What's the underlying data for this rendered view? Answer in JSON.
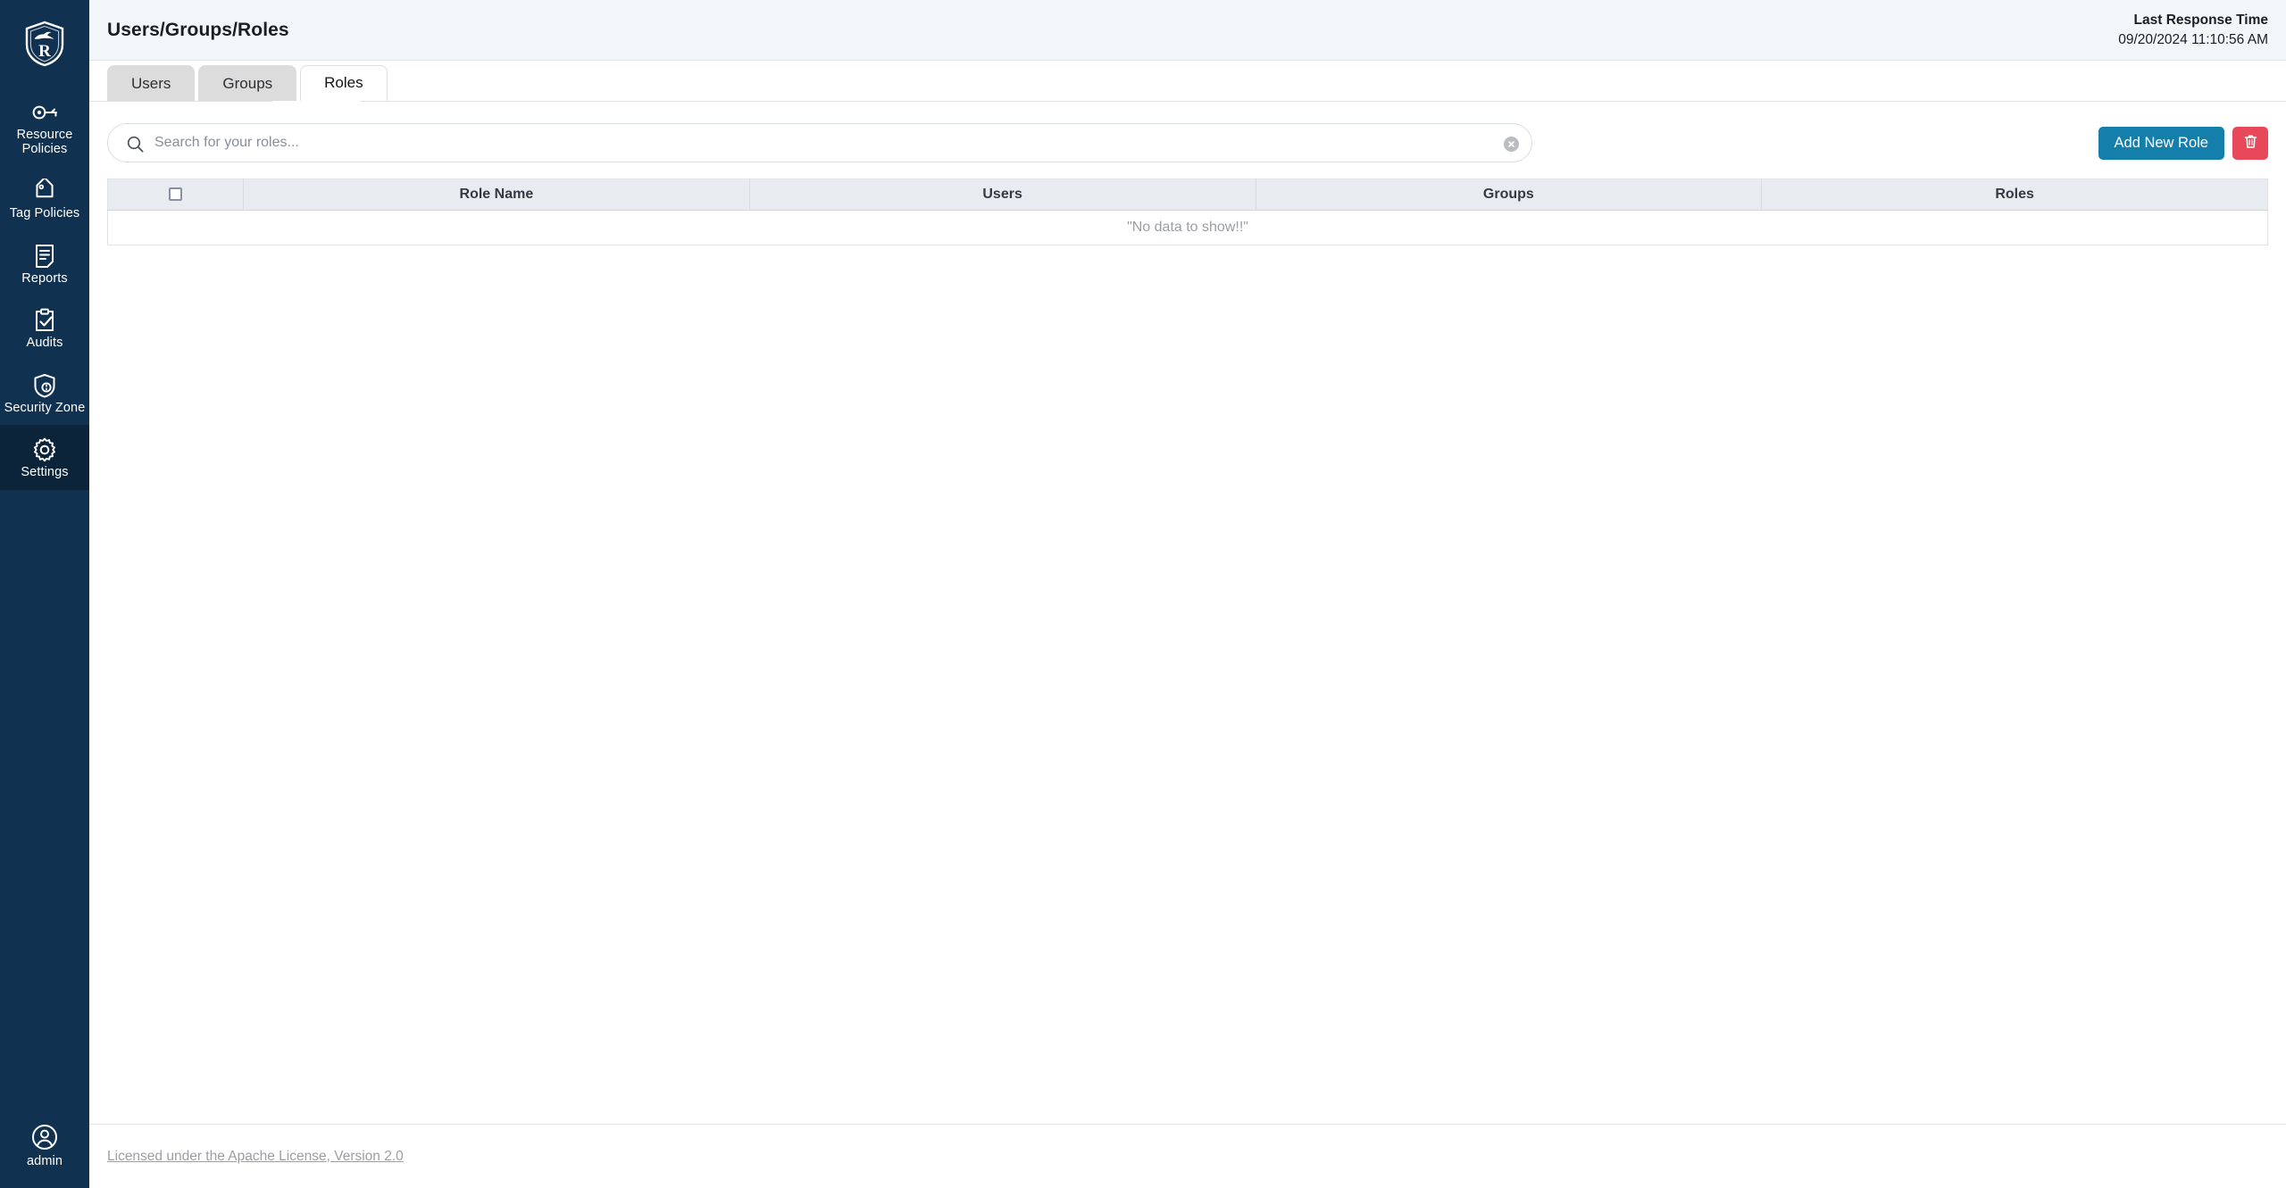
{
  "brand": {
    "logo_icon": "ranger-shield-logo",
    "accent_color": "#157fac",
    "danger_color": "#e8495a",
    "sidebar_color": "#113150",
    "header_bg_color": "#f1f7f8"
  },
  "sidebar": {
    "items": [
      {
        "label": "Resource Policies",
        "icon": "key-icon",
        "active": false
      },
      {
        "label": "Tag Policies",
        "icon": "tag-icon",
        "active": false
      },
      {
        "label": "Reports",
        "icon": "report-document-icon",
        "active": false
      },
      {
        "label": "Audits",
        "icon": "clipboard-check-icon",
        "active": false
      },
      {
        "label": "Security Zone",
        "icon": "shield-lock-icon",
        "active": false
      },
      {
        "label": "Settings",
        "icon": "gear-icon",
        "active": true
      }
    ],
    "user": {
      "label": "admin",
      "icon": "user-circle-icon"
    }
  },
  "header": {
    "title": "Users/Groups/Roles",
    "response_time_label": "Last Response Time",
    "response_time_value": "09/20/2024 11:10:56 AM"
  },
  "tabs": [
    {
      "label": "Users",
      "active": false
    },
    {
      "label": "Groups",
      "active": false
    },
    {
      "label": "Roles",
      "active": true
    }
  ],
  "search": {
    "placeholder": "Search for your roles...",
    "value": "",
    "search_icon": "search-icon",
    "clear_icon": "clear-circle-icon"
  },
  "actions": {
    "add_label": "Add New Role",
    "delete_icon": "trash-icon"
  },
  "table": {
    "columns": [
      "",
      "Role Name",
      "Users",
      "Groups",
      "Roles"
    ],
    "rows": [],
    "empty_message": "\"No data to show!!\"",
    "select_all_checkbox": false
  },
  "footer": {
    "license_text": "Licensed under the Apache License, Version 2.0"
  }
}
